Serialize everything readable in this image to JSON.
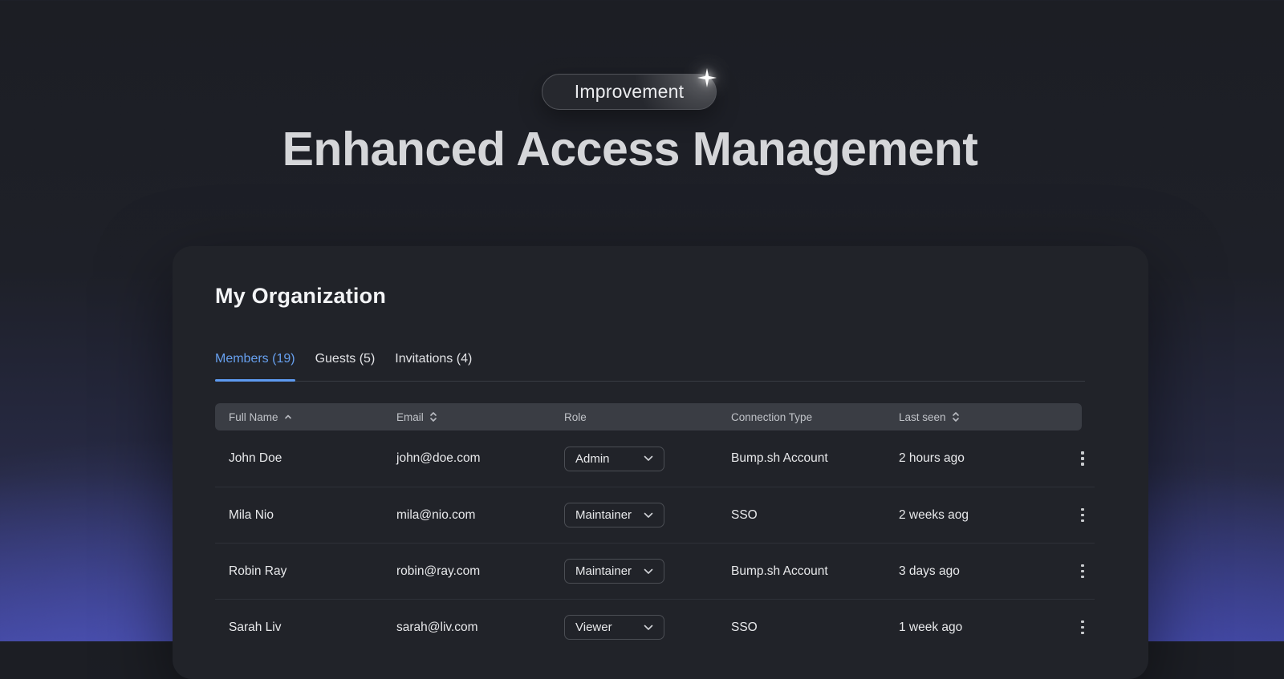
{
  "hero": {
    "badge_label": "Improvement",
    "title": "Enhanced Access Management",
    "badge_icon": "sparkle-icon"
  },
  "card": {
    "title": "My Organization",
    "tabs": [
      {
        "id": "members",
        "label": "Members (19)",
        "active": true
      },
      {
        "id": "guests",
        "label": "Guests (5)",
        "active": false
      },
      {
        "id": "invitations",
        "label": "Invitations (4)",
        "active": false
      }
    ],
    "table": {
      "columns": [
        {
          "label": "Full Name",
          "sort_icon": "caret-up-icon"
        },
        {
          "label": "Email",
          "sort_icon": "caret-up-down-icon"
        },
        {
          "label": "Role",
          "sort_icon": null
        },
        {
          "label": "Connection Type",
          "sort_icon": null
        },
        {
          "label": "Last seen",
          "sort_icon": "caret-up-down-icon"
        }
      ],
      "role_dropdown_icon": "chevron-down-icon",
      "row_action_icon": "kebab-menu-icon",
      "rows": [
        {
          "name": "John Doe",
          "email": "john@doe.com",
          "role": "Admin",
          "connection": "Bump.sh Account",
          "last_seen": "2 hours ago"
        },
        {
          "name": "Mila Nio",
          "email": "mila@nio.com",
          "role": "Maintainer",
          "connection": "SSO",
          "last_seen": "2 weeks aog"
        },
        {
          "name": "Robin Ray",
          "email": "robin@ray.com",
          "role": "Maintainer",
          "connection": "Bump.sh Account",
          "last_seen": "3 days ago"
        },
        {
          "name": "Sarah Liv",
          "email": "sarah@liv.com",
          "role": "Viewer",
          "connection": "SSO",
          "last_seen": "1 week ago"
        }
      ]
    }
  },
  "colors": {
    "accent_blue": "#5d9af0",
    "background_top": "#1c1e24",
    "background_indigo": "#3c4190",
    "card_background": "#212329",
    "table_header_background": "#3a3d44"
  }
}
